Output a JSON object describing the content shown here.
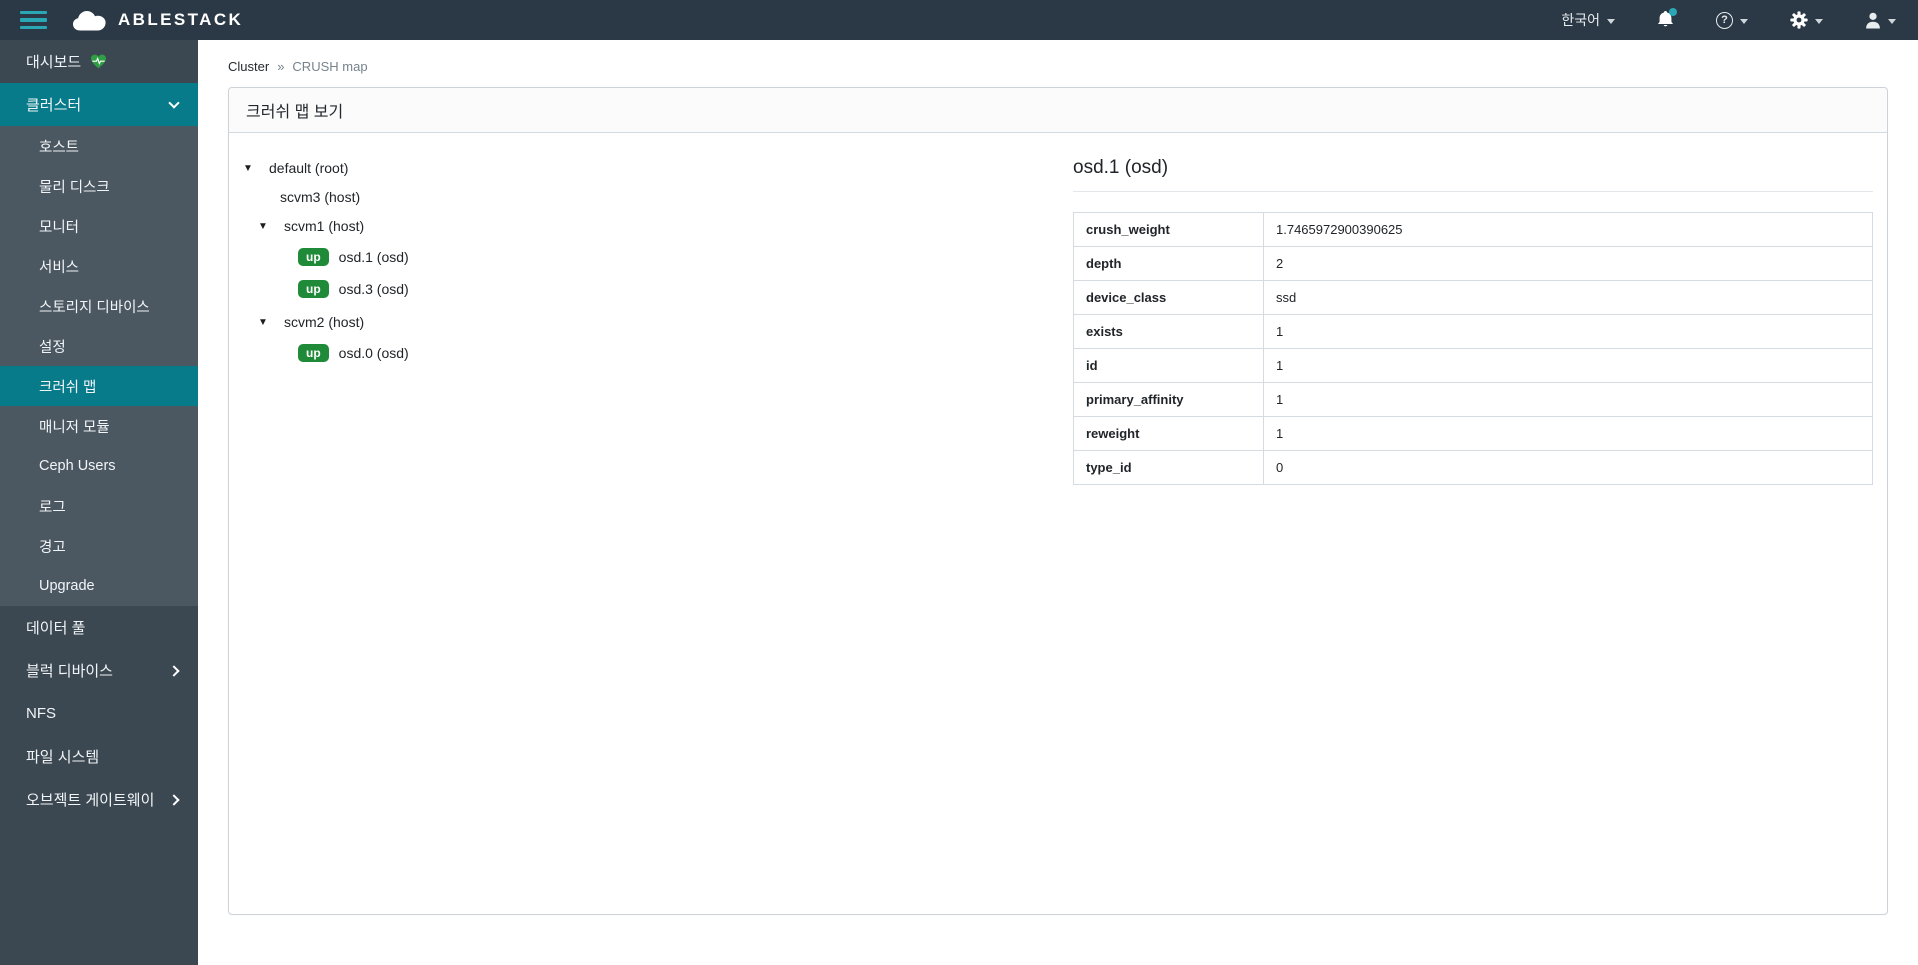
{
  "navbar": {
    "brand": "ABLESTACK",
    "language_label": "한국어",
    "help_glyph": "?"
  },
  "icons": {
    "tree_caret": "▼"
  },
  "breadcrumb": {
    "section": "Cluster",
    "separator": "»",
    "current": "CRUSH map"
  },
  "card": {
    "header": "크러쉬 맵 보기"
  },
  "sidebar": {
    "dashboard_label": "대시보드",
    "cluster_label": "클러스터",
    "cluster_children": [
      "호스트",
      "물리 디스크",
      "모니터",
      "서비스",
      "스토리지 디바이스",
      "설정",
      "크러쉬 맵",
      "매니저 모듈",
      "Ceph Users",
      "로그",
      "경고",
      "Upgrade"
    ],
    "active_child": "크러쉬 맵",
    "bottom_items": [
      "데이터 풀",
      "블럭 디바이스",
      "NFS",
      "파일 시스템",
      "오브젝트 게이트웨이"
    ]
  },
  "tree": {
    "rows": [
      {
        "label": "default (root)",
        "level": 0,
        "expandable": true
      },
      {
        "label": "scvm3 (host)",
        "level": 1,
        "expandable": false
      },
      {
        "label": "scvm1 (host)",
        "level": 1,
        "expandable": true
      },
      {
        "label": "osd.1 (osd)",
        "level": 2,
        "badge": "up"
      },
      {
        "label": "osd.3 (osd)",
        "level": 2,
        "badge": "up"
      },
      {
        "label": "scvm2 (host)",
        "level": 1,
        "expandable": true
      },
      {
        "label": "osd.0 (osd)",
        "level": 2,
        "badge": "up"
      }
    ]
  },
  "detail": {
    "title": "osd.1 (osd)",
    "rows": [
      {
        "key": "crush_weight",
        "value": "1.7465972900390625"
      },
      {
        "key": "depth",
        "value": "2"
      },
      {
        "key": "device_class",
        "value": "ssd"
      },
      {
        "key": "exists",
        "value": "1"
      },
      {
        "key": "id",
        "value": "1"
      },
      {
        "key": "primary_affinity",
        "value": "1"
      },
      {
        "key": "reweight",
        "value": "1"
      },
      {
        "key": "type_id",
        "value": "0"
      }
    ]
  },
  "colors": {
    "navbar_bg": "#2b3845",
    "sidebar_bg": "#3b4852",
    "submenu_bg": "#4b5862",
    "accent_teal": "#077b8a",
    "hamburger_teal": "#2aa7b5",
    "badge_green": "#1f8a38",
    "heart_green": "#2f9e44"
  }
}
